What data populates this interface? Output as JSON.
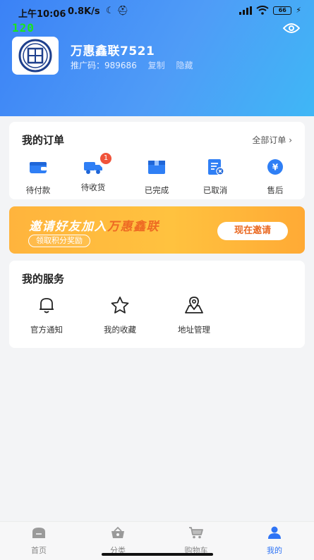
{
  "status_bar": {
    "time": "上午10:06",
    "speed": "0.8K/s",
    "battery": "66",
    "fps": "120"
  },
  "profile": {
    "shop_name": "万惠鑫联7521",
    "promo_label": "推广码：",
    "promo_code": "989686",
    "copy_label": "复制",
    "hide_label": "隐藏"
  },
  "orders": {
    "title": "我的订单",
    "all_label": "全部订单",
    "items": [
      {
        "label": "待付款",
        "icon": "wallet-icon"
      },
      {
        "label": "待收货",
        "icon": "truck-icon",
        "badge": "1"
      },
      {
        "label": "已完成",
        "icon": "box-icon"
      },
      {
        "label": "已取消",
        "icon": "cancel-doc-icon"
      },
      {
        "label": "售后",
        "icon": "yen-icon"
      }
    ]
  },
  "banner": {
    "headline_prefix": "邀请好友加入",
    "headline_brand": "万惠鑫联",
    "subtitle": "领取积分奖励",
    "button": "现在邀请"
  },
  "services": {
    "title": "我的服务",
    "items": [
      {
        "label": "官方通知",
        "icon": "bell-icon"
      },
      {
        "label": "我的收藏",
        "icon": "star-icon"
      },
      {
        "label": "地址管理",
        "icon": "location-icon"
      }
    ]
  },
  "tabbar": {
    "items": [
      {
        "label": "首页",
        "icon": "home-icon",
        "active": false
      },
      {
        "label": "分类",
        "icon": "category-basket-icon",
        "active": false
      },
      {
        "label": "购物车",
        "icon": "cart-icon",
        "active": false
      },
      {
        "label": "我的",
        "icon": "user-icon",
        "active": true
      }
    ]
  },
  "colors": {
    "primary": "#3b82f6",
    "accent_orange": "#ffb43d",
    "badge_red": "#f0533a"
  }
}
